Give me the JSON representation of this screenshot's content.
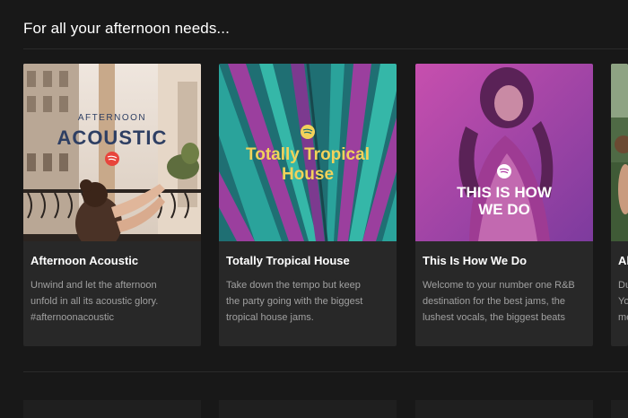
{
  "section": {
    "title": "For all your afternoon needs..."
  },
  "playlists": [
    {
      "title": "Afternoon Acoustic",
      "description_lines": [
        "Unwind and let the afternoon",
        "unfold in all its acoustic glory.",
        "#afternoonacoustic"
      ],
      "cover_text_top": "AFTERNOON",
      "cover_text_main": "ACOUSTIC"
    },
    {
      "title": "Totally Tropical House",
      "description_lines": [
        "Take down the tempo but keep",
        "the party going with the biggest",
        "tropical house jams."
      ],
      "cover_text_line1": "Totally Tropical",
      "cover_text_line2": "House"
    },
    {
      "title": "This Is How We Do",
      "description_lines": [
        "Welcome to your number one R&B",
        "destination for the best jams, the",
        "lushest vocals, the biggest beats"
      ],
      "cover_text_line1": "THIS IS HOW",
      "cover_text_line2": "WE DO"
    },
    {
      "title": "Al",
      "description_lines": [
        "Du",
        "Yo",
        "me"
      ]
    }
  ],
  "colors": {
    "background": "#181818",
    "card": "#282828",
    "title": "#ffffff",
    "description": "#a0a0a0",
    "acoustic_text": "#2e3f63",
    "acoustic_badge": "#e8453c",
    "tropical_text": "#f2d25a",
    "tropical_bg": "#2aa39b",
    "tropical_accent": "#9b3f9e",
    "howwedo_bg": "#b23fa4"
  },
  "icons": [
    "spotify-logo-icon"
  ]
}
